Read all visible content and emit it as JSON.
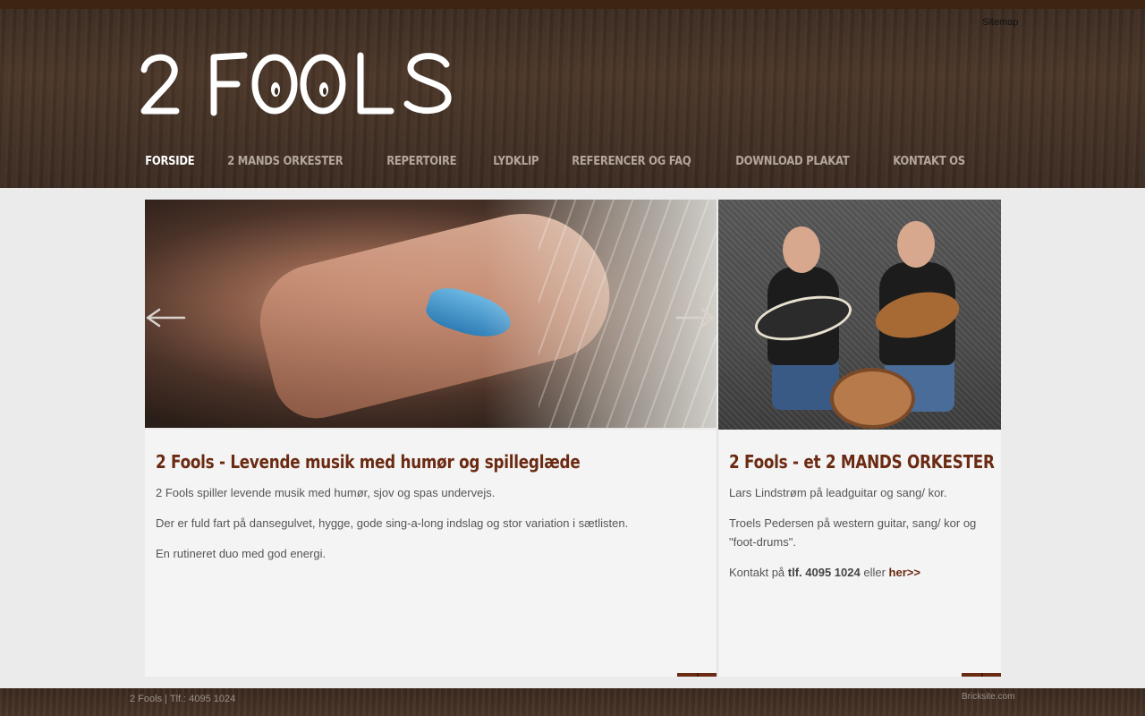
{
  "header": {
    "sitemap_link": "Sitemap",
    "logo_text": "2 FOOLS"
  },
  "nav": {
    "items": [
      {
        "label": "FORSIDE",
        "active": true
      },
      {
        "label": "2 MANDS ORKESTER",
        "active": false
      },
      {
        "label": "REPERTOIRE",
        "active": false
      },
      {
        "label": "LYDKLIP",
        "active": false
      },
      {
        "label": "REFERENCER OG FAQ",
        "active": false
      },
      {
        "label": "DOWNLOAD PLAKAT",
        "active": false
      },
      {
        "label": "KONTAKT OS",
        "active": false
      }
    ]
  },
  "slider": {
    "prev_icon": "arrow-left-icon",
    "next_icon": "arrow-right-icon"
  },
  "left_panel": {
    "title": "2 Fools - Levende musik med humør og spilleglæde",
    "paragraphs": [
      "2 Fools spiller levende musik med humør, sjov og spas undervejs.",
      "Der er fuld fart på dansegulvet, hygge, gode sing-a-long indslag og stor variation i sætlisten.",
      "En rutineret duo med god energi."
    ]
  },
  "right_panel": {
    "title": "2 Fools - et 2 MANDS ORKESTER",
    "paragraphs": [
      "Lars Lindstrøm på leadguitar og sang/ kor.",
      "Troels Pedersen på western guitar, sang/ kor og \"foot-drums\"."
    ],
    "contact_prefix": "Kontakt på ",
    "contact_phone": "tlf. 4095 1024",
    "contact_middle": " eller ",
    "contact_link": "her>>"
  },
  "footer": {
    "left_text": "2 Fools  | Tlf.: 4095 1024",
    "right_link": "Bricksite.com"
  },
  "colors": {
    "accent": "#6b2a12",
    "nav_active": "#ffffff",
    "nav_inactive": "#b3a69b",
    "header_bg": "#3f2d22"
  }
}
